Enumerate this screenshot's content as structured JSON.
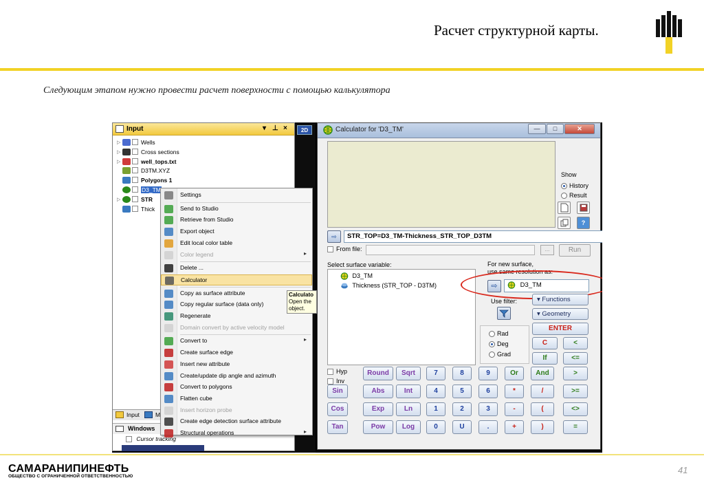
{
  "slide": {
    "title": "Расчет структурной карты.",
    "subtitle": "Следующим этапом нужно провести расчет поверхности с помощью калькулятора",
    "company_name": "САМАРАНИПИНЕФТЬ",
    "company_sub": "ОБЩЕСТВО С ОГРАНИЧЕННОЙ ОТВЕТСТВЕННОСТЬЮ",
    "page_number": "41",
    "accent_color": "#f2d226"
  },
  "input_panel": {
    "title": "Input",
    "items": [
      {
        "label": "Wells",
        "icon": "wells-icon",
        "bold": false,
        "selected": false
      },
      {
        "label": "Cross sections",
        "icon": "cross-sections-icon",
        "bold": false,
        "selected": false
      },
      {
        "label": "well_tops.txt",
        "icon": "well-tops-icon",
        "bold": true,
        "selected": false
      },
      {
        "label": "D3TM.XYZ",
        "icon": "points-icon",
        "bold": false,
        "selected": false
      },
      {
        "label": "Polygons 1",
        "icon": "polygons-icon",
        "bold": true,
        "selected": false
      },
      {
        "label": "D3_TM",
        "icon": "surface-icon",
        "bold": false,
        "selected": true
      },
      {
        "label": "STR",
        "icon": "surface-icon",
        "bold": true,
        "selected": false
      },
      {
        "label": "Thick",
        "icon": "thickness-icon",
        "bold": false,
        "selected": false
      }
    ],
    "bottom_tab_input": "Input",
    "bottom_tab_m": "M",
    "windows_label": "Windows",
    "cursor_tracking": "Cursor tracking"
  },
  "strip_label": "2D",
  "context_menu": {
    "items": [
      {
        "label": "Settings",
        "icon": "settings-icon",
        "disabled": false,
        "submenu": false
      },
      {
        "label": "Send to Studio",
        "icon": "send-to-studio-icon",
        "disabled": false,
        "submenu": false
      },
      {
        "label": "Retrieve from Studio",
        "icon": "retrieve-from-studio-icon",
        "disabled": false,
        "submenu": false
      },
      {
        "label": "Export object",
        "icon": "export-icon",
        "disabled": false,
        "submenu": false
      },
      {
        "label": "Edit local color table",
        "icon": "color-table-icon",
        "disabled": false,
        "submenu": false
      },
      {
        "label": "Color legend",
        "icon": "color-legend-icon",
        "disabled": true,
        "submenu": true
      },
      {
        "label": "Delete ...",
        "icon": "delete-icon",
        "disabled": false,
        "submenu": false
      },
      {
        "label": "Calculator",
        "icon": "calculator-icon",
        "disabled": false,
        "submenu": false,
        "highlight": true
      },
      {
        "label": "Copy as surface attribute",
        "icon": "copy-icon",
        "disabled": false,
        "submenu": false
      },
      {
        "label": "Copy regular surface (data only)",
        "icon": "copy-icon",
        "disabled": false,
        "submenu": false
      },
      {
        "label": "Regenerate",
        "icon": "regenerate-icon",
        "disabled": false,
        "submenu": false
      },
      {
        "label": "Domain convert by active velocity model",
        "icon": "domain-convert-icon",
        "disabled": true,
        "submenu": false
      },
      {
        "label": "Convert to",
        "icon": "convert-icon",
        "disabled": false,
        "submenu": true
      },
      {
        "label": "Create surface edge",
        "icon": "surface-edge-icon",
        "disabled": false,
        "submenu": false
      },
      {
        "label": "Insert new attribute",
        "icon": "attribute-icon",
        "disabled": false,
        "submenu": false
      },
      {
        "label": "Create/update dip angle and azimuth",
        "icon": "dip-angle-icon",
        "disabled": false,
        "submenu": false
      },
      {
        "label": "Convert to polygons",
        "icon": "polygons-icon",
        "disabled": false,
        "submenu": false
      },
      {
        "label": "Flatten cube",
        "icon": "flatten-icon",
        "disabled": false,
        "submenu": false
      },
      {
        "label": "Insert horizon probe",
        "icon": "horizon-probe-icon",
        "disabled": true,
        "submenu": false
      },
      {
        "label": "Create edge detection surface attribute",
        "icon": "edge-detection-icon",
        "disabled": false,
        "submenu": false
      },
      {
        "label": "Structural operations",
        "icon": "structural-icon",
        "disabled": false,
        "submenu": true
      }
    ],
    "tooltip_title": "Calculato",
    "tooltip_line1": "Open the",
    "tooltip_line2": "object."
  },
  "calculator": {
    "window_title": "Calculator for 'D3_TM'",
    "show_label": "Show",
    "show_history": "History",
    "show_result": "Result",
    "expression": "STR_TOP=D3_TM-Thickness_STR_TOP_D3TM",
    "from_file_label": "From file:",
    "browse_label": "...",
    "run_label": "Run",
    "select_label": "Select surface variable:",
    "variables": [
      {
        "label": "D3_TM",
        "icon": "surface-icon"
      },
      {
        "label": "Thickness (STR_TOP - D3TM)",
        "icon": "thickness-icon"
      }
    ],
    "new_surface_line1": "For new surface,",
    "new_surface_line2": "use same resolution as:",
    "resolution_surface": "D3_TM",
    "use_filter_label": "Use filter:",
    "functions_label": "Functions",
    "geometry_label": "Geometry",
    "enter_label": "ENTER",
    "angle_options": [
      "Rad",
      "Deg",
      "Grad"
    ],
    "angle_selected": "Deg",
    "hyp_label": "Hyp",
    "inv_label": "Inv",
    "keys": {
      "round": "Round",
      "sqrt": "Sqrt",
      "sin": "Sin",
      "abs": "Abs",
      "int": "Int",
      "cos": "Cos",
      "exp": "Exp",
      "ln": "Ln",
      "tan": "Tan",
      "pow": "Pow",
      "log": "Log",
      "d7": "7",
      "d8": "8",
      "d9": "9",
      "d4": "4",
      "d5": "5",
      "d6": "6",
      "d1": "1",
      "d2": "2",
      "d3": "3",
      "d0": "0",
      "u": "U",
      "dot": ".",
      "or": "Or",
      "and": "And",
      "mul": "*",
      "div": "/",
      "minus": "-",
      "plus": "+",
      "lparen": "(",
      "rparen": ")",
      "c": "C",
      "if": "If",
      "lt": "<",
      "le": "<=",
      "gt": ">",
      "ge": ">=",
      "ne": "<>",
      "eq": "="
    }
  }
}
